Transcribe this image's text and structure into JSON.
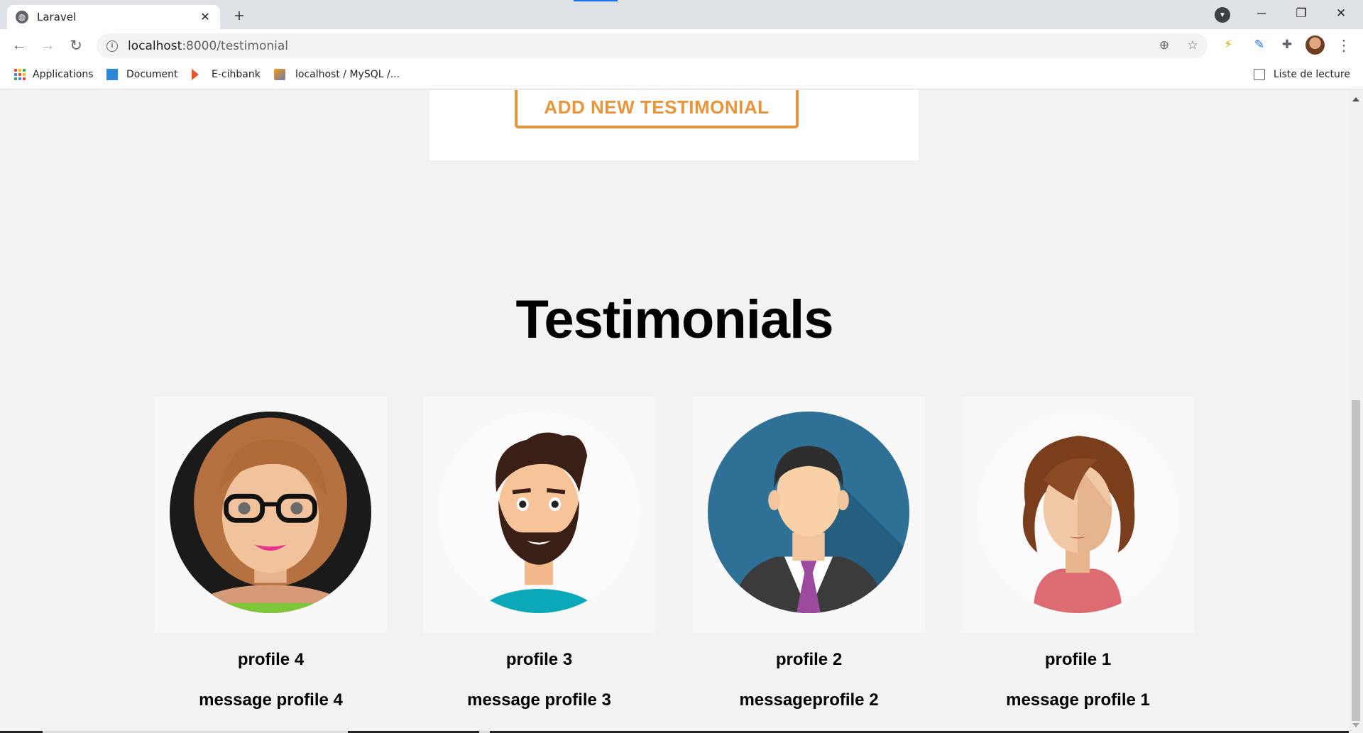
{
  "browser": {
    "tab_title": "Laravel",
    "url_host": "localhost",
    "url_path": ":8000/testimonial",
    "bookmarks": [
      {
        "label": "Applications"
      },
      {
        "label": "Document"
      },
      {
        "label": "E-cihbank"
      },
      {
        "label": "localhost / MySQL /..."
      }
    ],
    "reading_list_label": "Liste de lecture",
    "accent_color": "#1a73e8"
  },
  "page": {
    "add_button_label": "ADD NEW TESTIMONIAL",
    "section_title": "Testimonials",
    "accent_color": "#e8943a",
    "testimonials": [
      {
        "name": "profile 4",
        "message": "message profile 4",
        "avatar": "woman-glasses-avatar"
      },
      {
        "name": "profile 3",
        "message": "message profile 3",
        "avatar": "bearded-man-avatar"
      },
      {
        "name": "profile 2",
        "message": "messageprofile 2",
        "avatar": "businessman-avatar"
      },
      {
        "name": "profile 1",
        "message": "message profile 1",
        "avatar": "curly-woman-avatar"
      }
    ]
  }
}
